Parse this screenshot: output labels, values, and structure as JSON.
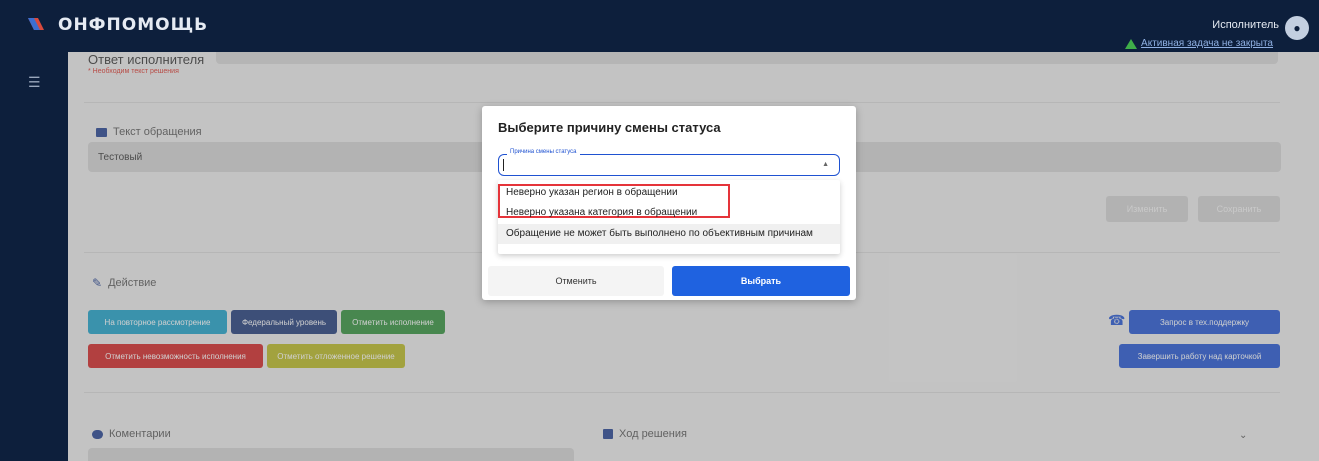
{
  "app": {
    "logo_text": "ОНФПОМОЩЬ",
    "user_role": "Исполнитель",
    "alert_text": "Активная задача не закрыта"
  },
  "response": {
    "title": "Ответ исполнителя",
    "required_hint": "* Необходим текст решения"
  },
  "request_text": {
    "title": "Текст обращения",
    "value": "Тестовый"
  },
  "top_buttons": {
    "change": "Изменить",
    "save": "Сохранить"
  },
  "action": {
    "title": "Действие",
    "buttons": {
      "repeat_review": "На повторное рассмотрение",
      "federal_level": "Федеральный уровень",
      "mark_done": "Отметить исполнение",
      "mark_impossible": "Отметить невозможность исполнения",
      "mark_postponed": "Отметить отложенное решение",
      "support_request": "Запрос в тех.поддержку",
      "finish_work": "Завершить работу над карточкой"
    }
  },
  "comments": {
    "title": "Коментарии"
  },
  "progress": {
    "title": "Ход решения"
  },
  "modal": {
    "title": "Выберите причину смены статуса",
    "select_label": "Причина смены статуса",
    "options": [
      "Неверно указан регион в обращении",
      "Неверно указана категория в обращении",
      "Обращение не может быть выполнено по объективным причинам"
    ],
    "cancel": "Отменить",
    "confirm": "Выбрать"
  },
  "colors": {
    "navy": "#0d1f3c",
    "accent_blue": "#1f62e0",
    "teal": "#1aa0c8",
    "dark_blue": "#1e3a78",
    "green": "#2f8f3a",
    "red": "#d22222",
    "olive": "#b8b820",
    "highlight_red": "#e5343a"
  }
}
